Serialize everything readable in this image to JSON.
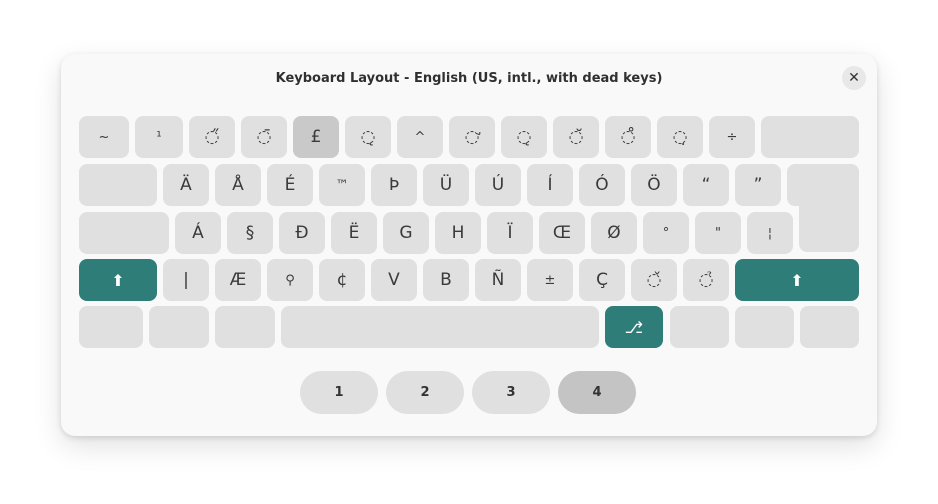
{
  "dialog": {
    "title": "Keyboard Layout - English (US, intl., with dead keys)",
    "close_glyph": "✕"
  },
  "rows": [
    [
      "~",
      "¹",
      "̋",
      "̄",
      "£",
      "̨",
      "^",
      "̛",
      "̨",
      "̆",
      "̊",
      "̣",
      "÷",
      ""
    ],
    [
      "",
      "Ä",
      "Å",
      "É",
      "™",
      "Þ",
      "Ü",
      "Ú",
      "Í",
      "Ó",
      "Ö",
      "“",
      "”"
    ],
    [
      "",
      "Á",
      "§",
      "Ð",
      "Ë",
      "G",
      "H",
      "Ï",
      "Œ",
      "Ø",
      "°",
      "\"",
      "¦"
    ],
    [
      "⬆",
      "|",
      "Æ",
      "⚲",
      "¢",
      "V",
      "B",
      "Ñ",
      "±",
      "Ç",
      "̌",
      "̉",
      "⬆"
    ],
    [
      "",
      "",
      "",
      "",
      "⎇",
      "",
      "",
      ""
    ]
  ],
  "pages": [
    "1",
    "2",
    "3",
    "4"
  ],
  "active_page": "4",
  "colors": {
    "accent": "#2f7d78",
    "key": "#e0e0e0",
    "key_pressed": "#c9c9c9",
    "dialog_bg": "#f9f9f9"
  }
}
